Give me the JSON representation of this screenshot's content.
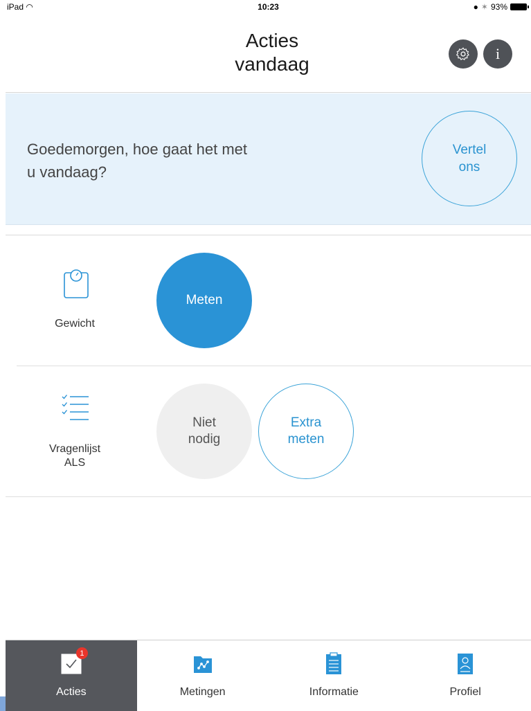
{
  "status_bar": {
    "device": "iPad",
    "time": "10:23",
    "battery": "93%"
  },
  "header": {
    "title_line1": "Acties",
    "title_line2": "vandaag",
    "settings_icon": "gear-icon",
    "info_icon": "info-icon",
    "info_glyph": "i"
  },
  "greeting": {
    "line1": "Goedemorgen, hoe gaat het met",
    "line2": "u vandaag?",
    "button_line1": "Vertel",
    "button_line2": "ons"
  },
  "actions": [
    {
      "label_line1": "Gewicht",
      "label_line2": "",
      "icon": "scale-icon",
      "buttons": [
        {
          "line1": "Meten",
          "line2": "",
          "style": "primary"
        }
      ]
    },
    {
      "label_line1": "Vragenlijst",
      "label_line2": "ALS",
      "icon": "checklist-icon",
      "buttons": [
        {
          "line1": "Niet",
          "line2": "nodig",
          "style": "gray"
        },
        {
          "line1": "Extra",
          "line2": "meten",
          "style": "outline"
        }
      ]
    }
  ],
  "tabs": [
    {
      "label": "Acties",
      "icon": "checkbox-icon",
      "active": true,
      "badge": "1"
    },
    {
      "label": "Metingen",
      "icon": "chart-folder-icon",
      "active": false
    },
    {
      "label": "Informatie",
      "icon": "clipboard-icon",
      "active": false
    },
    {
      "label": "Profiel",
      "icon": "profile-icon",
      "active": false
    }
  ],
  "colors": {
    "accent": "#2a93d6",
    "greeting_bg": "#e6f2fb",
    "header_button": "#4f5257",
    "active_tab": "#55575c",
    "badge": "#e8352b"
  }
}
